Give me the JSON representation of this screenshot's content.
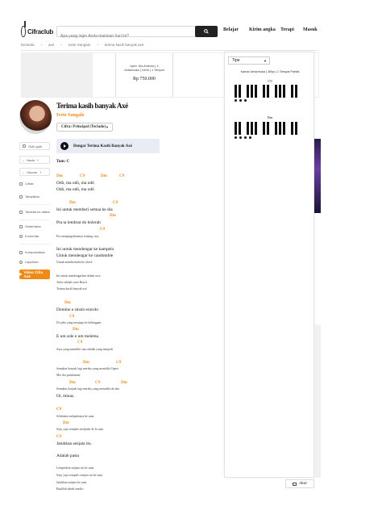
{
  "header": {
    "logo_text": "Cifraclub",
    "search_placeholder": "Apa yang ingin Anda mainkan hari ini?",
    "nav": [
      "Belajar",
      "Kirim angka",
      "Terapi",
      "Masuk"
    ]
  },
  "breadcrumb": [
    "beranda",
    "axé",
    "Ivete Sangalo",
    "terima kasih banyak axé"
  ],
  "banner": {
    "product_text_1": "Apex 16a Android | 4",
    "product_text_2": "Antarmuka | 16Gb | 1 Tempat",
    "price": "Rp 750.000"
  },
  "chord_panel": {
    "type_label": "Tipe",
    "subtitle": "Kamar Antarmuka | 4Bsp | 1 Tempat Parfait",
    "chords": [
      "C9",
      "Dm"
    ]
  },
  "song": {
    "title": "Terima kasih banyak Axé",
    "artist": "Ivete Sangalo",
    "version": "Cifra: Principal (Teclado)"
  },
  "tools": {
    "auto_scroll": "Gulir gulir",
    "tone": "Nada",
    "size": "Ukuran",
    "print": "Cetak",
    "edit": "Tampilkan",
    "add_list": "Tambah ke daftar",
    "simplify": "Sederhana",
    "comment": "Komentar",
    "compose": "Komposisikan",
    "report": "Laporkan",
    "video_btn": "Video Cifra Axé"
  },
  "audio": {
    "label": "Dengar Terima Kasih Banyak Axé"
  },
  "sheet": {
    "tom": "Tom: C",
    "lines": [
      {
        "text": "Odô, ma odô, ma odô",
        "cls": "lyr"
      },
      {
        "text": "Odô, ma odô, ma odô",
        "cls": "lyr"
      },
      {
        "text": "Ini untuk memberi semua ke dia",
        "cls": "lyr"
      },
      {
        "text": "Pra ta lembrar do bolerah",
        "cls": "lyr"
      },
      {
        "text": "Pra mengingatkannya tentang cara",
        "cls": "small"
      },
      {
        "text": "Ini untuk mendengar ke kampelo",
        "cls": "lyr"
      },
      {
        "text": "Untuk mendengar ke candomble",
        "cls": "lyr"
      },
      {
        "text": "Untuk memberitahu ke afoxé",
        "cls": "small2"
      },
      {
        "text": "Ini untuk mendengarkan dalam rasa",
        "cls": "small"
      },
      {
        "text": "Tulus adalah cinta Brasil",
        "cls": "small"
      },
      {
        "text": "Terima kasih banyak axé",
        "cls": "small"
      },
      {
        "text": "Domine e sinsin erorolo",
        "cls": "lyr"
      },
      {
        "text": "Di pilas yang menjaga ke kehinggan",
        "cls": "small"
      },
      {
        "text": "E um sole e um melema",
        "cls": "lyr"
      },
      {
        "text": "Saya yang memiliki satu adalah yang menjadi",
        "cls": "small"
      },
      {
        "text": "Semakin banyak lagi mereka yang memiliki Opere",
        "cls": "small"
      },
      {
        "text": "Mer dia pendamme",
        "cls": "small"
      },
      {
        "text": "Semakin banyak lagi mereka yang memiliki de alm",
        "cls": "small"
      },
      {
        "text": "Oi, minas.",
        "cls": "lyr"
      },
      {
        "text": "Selalukan melpahanya ke sana",
        "cls": "small"
      },
      {
        "text": "Saja, yaja sempelo melpahe de la sana",
        "cls": "small"
      },
      {
        "text": "Jatuhkan senjata itu.",
        "cls": "lyr"
      },
      {
        "text": "Adalah pasta",
        "cls": "lyr"
      },
      {
        "text": "Lempeskan senjata itu ke sana",
        "cls": "small"
      },
      {
        "text": "Saja, yaja sempelo senjata itu ke sana",
        "cls": "small"
      },
      {
        "text": "Jatuhkan senjata ke sana",
        "cls": "small"
      },
      {
        "text": "Buaklah tubuh sendiri",
        "cls": "small"
      }
    ],
    "chord_labels": [
      "Dm",
      "C9",
      "Dm",
      "C9",
      "Dm",
      "C9",
      "Dm",
      "C9",
      "Dm",
      "C9",
      "Dm",
      "C9",
      "Dm",
      "C9",
      "Dm",
      "C9",
      "Dm",
      "C9",
      "Dm",
      "C9"
    ]
  },
  "akor_btn": "Akor"
}
